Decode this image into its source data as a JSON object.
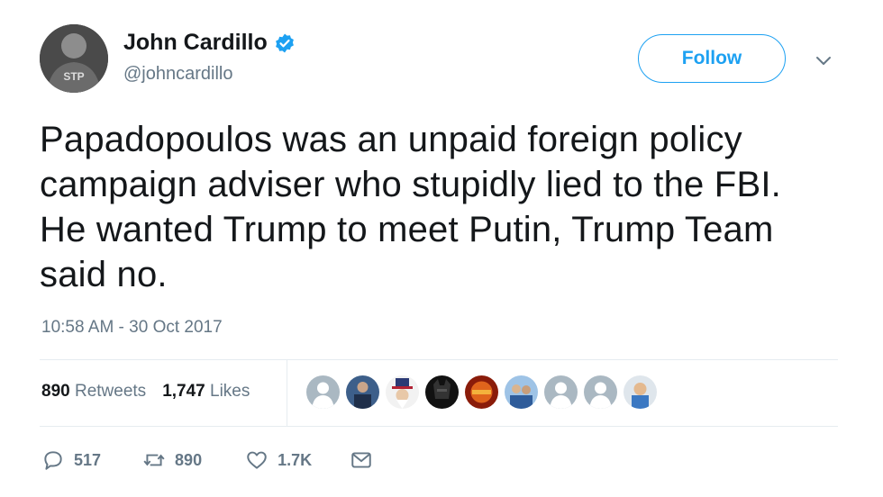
{
  "author": {
    "name": "John Cardillo",
    "handle": "@johncardillo",
    "avatar_shirt_text": "STP"
  },
  "header": {
    "follow_label": "Follow"
  },
  "tweet": {
    "lines": [
      "Papadopoulos was an unpaid foreign policy",
      "campaign adviser who stupidly lied to the FBI.",
      "He wanted Trump to meet Putin, Trump Team",
      "said no."
    ],
    "timestamp": "10:58 AM - 30 Oct 2017"
  },
  "stats": {
    "retweets_count": "890",
    "retweets_label": "Retweets",
    "likes_count": "1,747",
    "likes_label": "Likes"
  },
  "actions": {
    "reply_count": "517",
    "retweet_count": "890",
    "like_count": "1.7K"
  },
  "colors": {
    "brand": "#1da1f2",
    "muted": "#657786",
    "text": "#14171a"
  }
}
